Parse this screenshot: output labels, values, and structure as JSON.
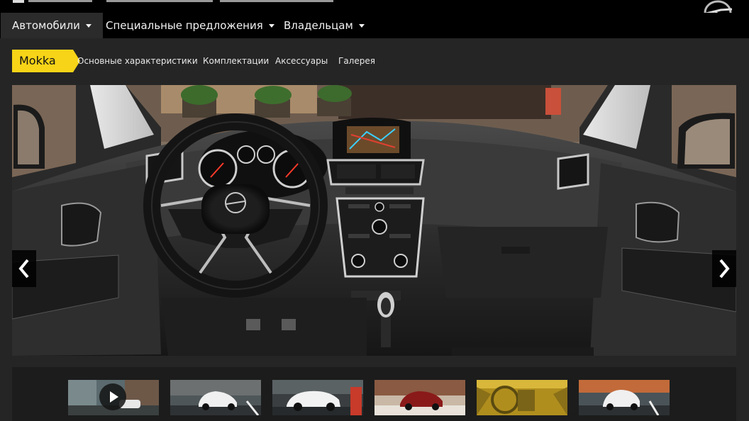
{
  "nav": {
    "items": [
      {
        "label": "Автомобили"
      },
      {
        "label": "Специальные предложения"
      },
      {
        "label": "Владельцам"
      }
    ]
  },
  "subnav": {
    "model": "Mokka",
    "links": [
      {
        "label": "Основные характеристики"
      },
      {
        "label": "Комплектации"
      },
      {
        "label": "Аксессуары"
      },
      {
        "label": "Галерея"
      }
    ]
  },
  "gallery": {
    "prev_icon": "chevron-left-icon",
    "next_icon": "chevron-right-icon",
    "thumbnails": [
      {
        "name": "thumb-video",
        "icon": "play-icon"
      },
      {
        "name": "thumb-white-front"
      },
      {
        "name": "thumb-white-side"
      },
      {
        "name": "thumb-red-car"
      },
      {
        "name": "thumb-interior-gold"
      },
      {
        "name": "thumb-white-rear"
      }
    ]
  },
  "colors": {
    "accent": "#f7d417",
    "background": "#000000",
    "panel": "#252525"
  }
}
